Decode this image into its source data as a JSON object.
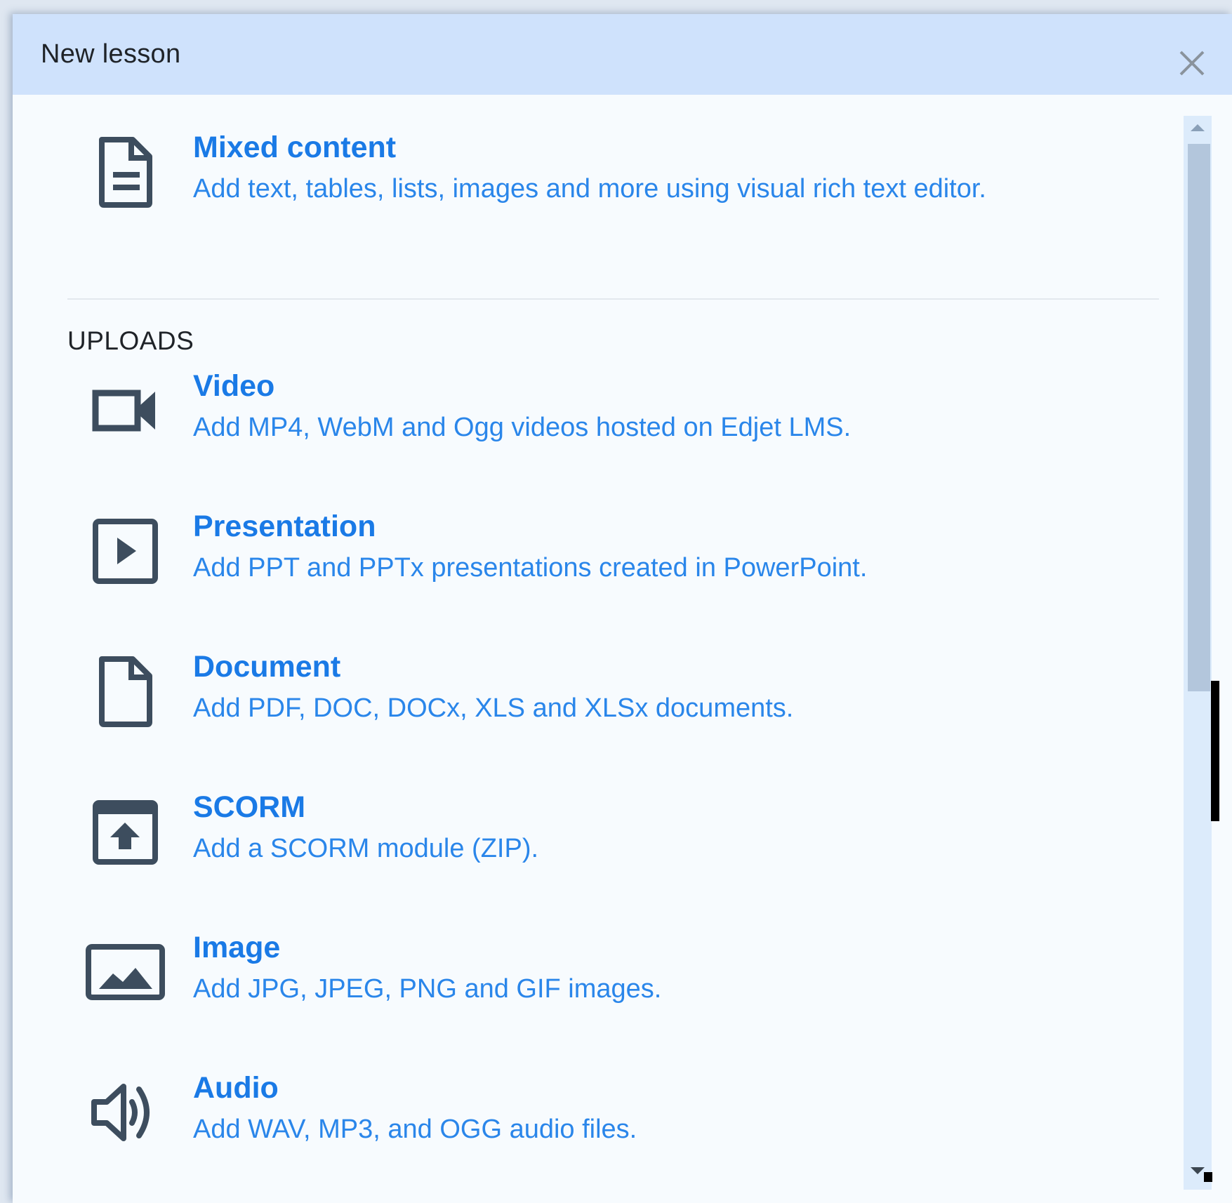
{
  "dialog": {
    "title": "New lesson",
    "close_icon": "close-icon"
  },
  "mixed": {
    "icon": "document-lines-icon",
    "title": "Mixed content",
    "description": "Add text, tables, lists, images and more using visual rich text editor."
  },
  "uploads": {
    "heading": "UPLOADS",
    "items": [
      {
        "icon": "video-camera-icon",
        "title": "Video",
        "description": "Add MP4, WebM and Ogg videos hosted on Edjet LMS."
      },
      {
        "icon": "presentation-play-icon",
        "title": "Presentation",
        "description": "Add PPT and PPTx presentations created in PowerPoint."
      },
      {
        "icon": "document-icon",
        "title": "Document",
        "description": "Add PDF, DOC, DOCx, XLS and XLSx documents."
      },
      {
        "icon": "scorm-upload-icon",
        "title": "SCORM",
        "description": "Add a SCORM module (ZIP)."
      },
      {
        "icon": "image-icon",
        "title": "Image",
        "description": "Add JPG, JPEG, PNG and GIF images."
      },
      {
        "icon": "speaker-icon",
        "title": "Audio",
        "description": "Add WAV, MP3, and OGG audio files."
      }
    ]
  },
  "colors": {
    "header": "#cfe2fc",
    "accent": "#1a7ae6",
    "icon": "#3d4d5e"
  }
}
